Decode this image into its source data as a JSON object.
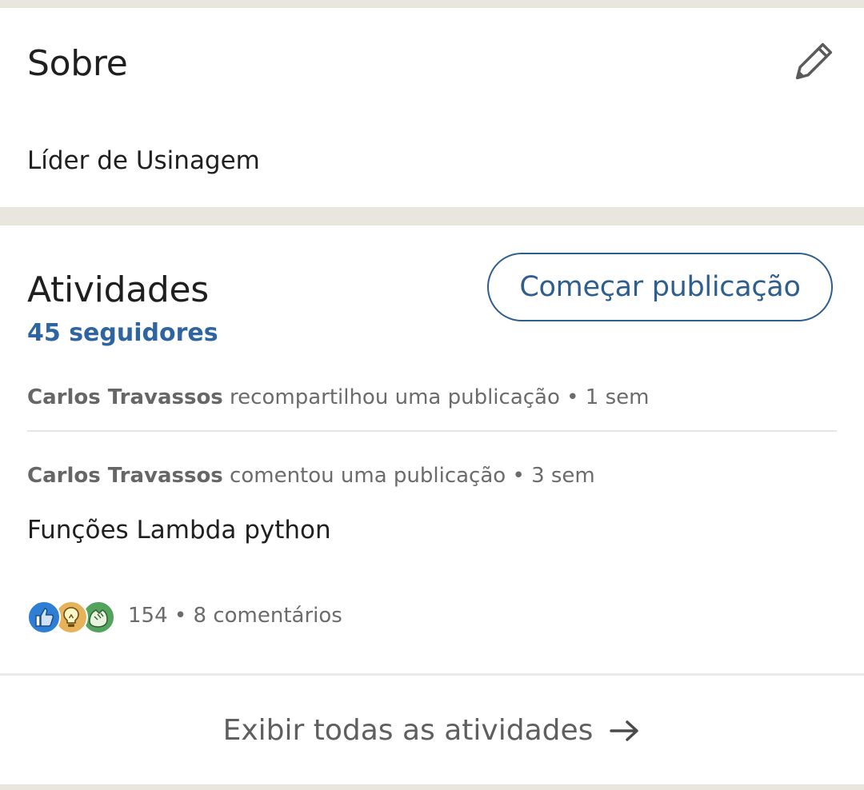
{
  "about": {
    "title": "Sobre",
    "text": "Líder de Usinagem",
    "edit_icon": "pencil-icon"
  },
  "activity": {
    "title": "Atividades",
    "followers": "45 seguidores",
    "start_post_label": "Começar publicação",
    "items": [
      {
        "actor": "Carlos Travassos",
        "action": "recompartilhou uma publicação",
        "separator": "•",
        "time": "1 sem"
      },
      {
        "actor": "Carlos Travassos",
        "action": "comentou uma publicação",
        "separator": "•",
        "time": "3 sem",
        "post_title": "Funções Lambda python",
        "reactions": {
          "icons": [
            "like-reaction-icon",
            "insightful-reaction-icon",
            "celebrate-reaction-icon"
          ],
          "count": "154",
          "separator": "•",
          "comments": "8 comentários"
        }
      }
    ],
    "show_all_label": "Exibir todas as atividades",
    "show_all_icon": "arrow-right-icon"
  },
  "colors": {
    "page_background": "#e9e5df",
    "card_background": "#ffffff",
    "link_blue": "#2e64a0",
    "button_border": "#2e5e8e",
    "text_primary": "#1f1f1f",
    "text_secondary": "#6b6b6b"
  }
}
